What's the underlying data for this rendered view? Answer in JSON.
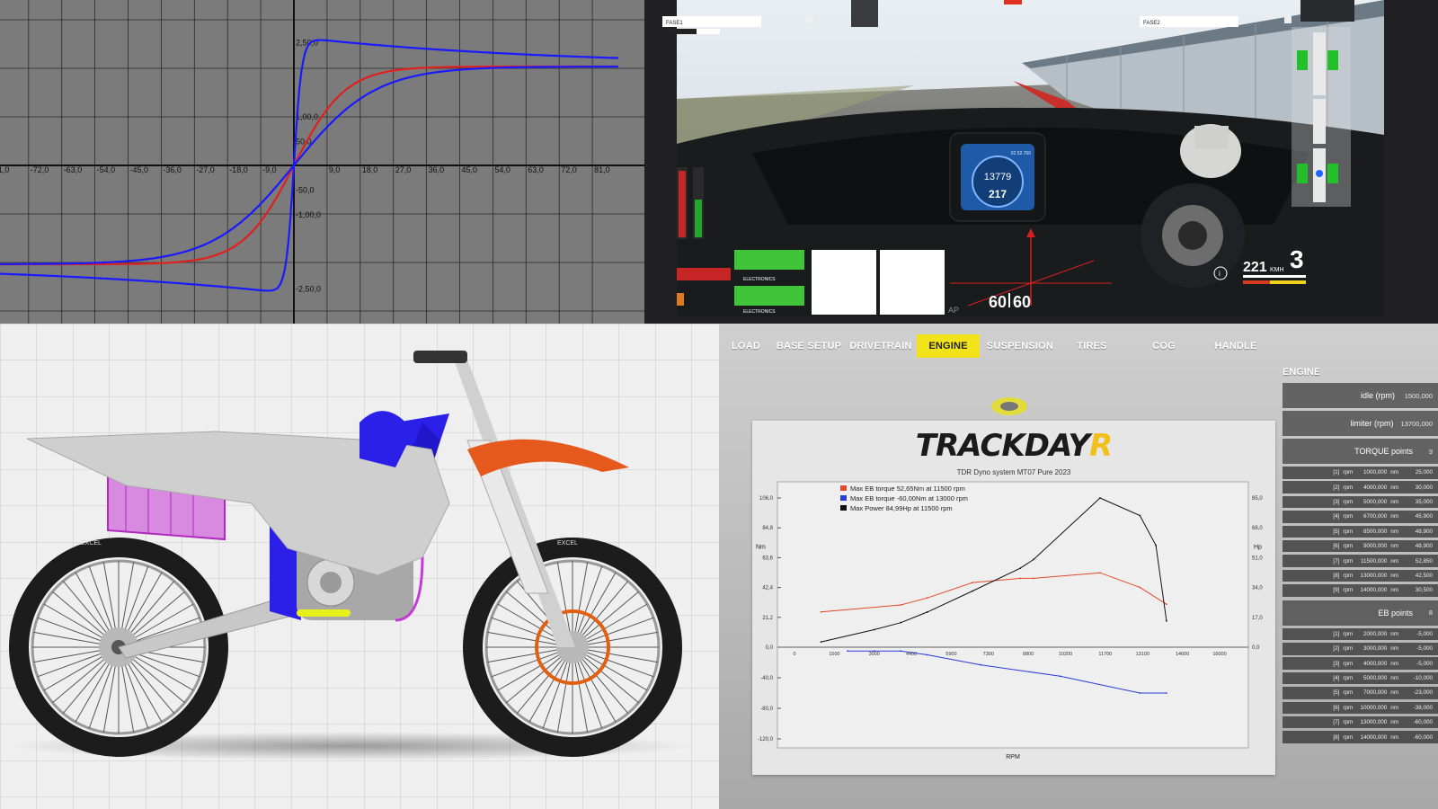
{
  "curve_panel": {
    "x_ticks": [
      "81,0",
      "-72,0",
      "-63,0",
      "-54,0",
      "-45,0",
      "-36,0",
      "-27,0",
      "-18,0",
      "-9,0",
      "9,0",
      "18,0",
      "27,0",
      "36,0",
      "45,0",
      "54,0",
      "63,0",
      "72,0",
      "81,0"
    ],
    "y_ticks": [
      "2,50,0",
      "1,00,0",
      "50,0",
      "-50,0",
      "-1,00,0",
      "-2,50,0"
    ],
    "colors": {
      "bg": "#7b7b7b",
      "grid": "#2b2b2b",
      "curve_a": "#1a1aff",
      "curve_b": "#e02020"
    }
  },
  "sim_panel": {
    "phase_left": "FASE1",
    "phase_right": "FASE2",
    "dash_rpm": "13779",
    "dash_speed": "217",
    "dash_lap": "02.52.766",
    "speed_readout": "221",
    "speed_unit": "KMH",
    "gear": "3",
    "fps_left": "60",
    "fps_right": "60",
    "tile_label": "ELECTRONICS",
    "overlay_text": "AP"
  },
  "bike_panel": {
    "tyre_brand": "EXCEL"
  },
  "tool_panel": {
    "nav": [
      {
        "label": "LOAD",
        "active": false
      },
      {
        "label": "BASE SETUP",
        "active": false
      },
      {
        "label": "DRIVETRAIN",
        "active": false
      },
      {
        "label": "ENGINE",
        "active": true
      },
      {
        "label": "SUSPENSION",
        "active": false
      },
      {
        "label": "TIRES",
        "active": false
      },
      {
        "label": "COG",
        "active": false
      },
      {
        "label": "HANDLE",
        "active": false
      }
    ],
    "section_title": "ENGINE",
    "idle_label": "idle (rpm)",
    "idle_value": "1500,000",
    "limiter_label": "limiter (rpm)",
    "limiter_value": "13700,000",
    "torque_points_label": "TORQUE points",
    "torque_points_count": "9",
    "torque_points": [
      {
        "idx": "[1]",
        "rpm": "1000,000",
        "nm": "25,000"
      },
      {
        "idx": "[2]",
        "rpm": "4000,000",
        "nm": "30,000"
      },
      {
        "idx": "[3]",
        "rpm": "5000,000",
        "nm": "35,000"
      },
      {
        "idx": "[4]",
        "rpm": "6700,000",
        "nm": "45,900"
      },
      {
        "idx": "[5]",
        "rpm": "8500,000",
        "nm": "48,900"
      },
      {
        "idx": "[6]",
        "rpm": "9000,000",
        "nm": "48,900"
      },
      {
        "idx": "[7]",
        "rpm": "11500,000",
        "nm": "52,850"
      },
      {
        "idx": "[8]",
        "rpm": "13000,000",
        "nm": "42,500"
      },
      {
        "idx": "[9]",
        "rpm": "14000,000",
        "nm": "30,500"
      }
    ],
    "eb_points_label": "EB points",
    "eb_points_count": "8",
    "eb_points": [
      {
        "idx": "[1]",
        "rpm": "2000,000",
        "nm": "-5,000"
      },
      {
        "idx": "[2]",
        "rpm": "3000,000",
        "nm": "-5,000"
      },
      {
        "idx": "[3]",
        "rpm": "4000,000",
        "nm": "-5,000"
      },
      {
        "idx": "[4]",
        "rpm": "5000,000",
        "nm": "-10,000"
      },
      {
        "idx": "[5]",
        "rpm": "7000,000",
        "nm": "-23,000"
      },
      {
        "idx": "[6]",
        "rpm": "10000,000",
        "nm": "-38,000"
      },
      {
        "idx": "[7]",
        "rpm": "13000,000",
        "nm": "-60,000"
      },
      {
        "idx": "[8]",
        "rpm": "14000,000",
        "nm": "-60,000"
      }
    ],
    "rpm_word": "rpm",
    "nm_word": "nm",
    "logo_main": "TRACKDAY",
    "logo_accent": "R",
    "dyno_title": "TDR Dyno system MT07 Pure 2023"
  },
  "chart_data": {
    "type": "line",
    "title": "TDR Dyno system MT07 Pure 2023",
    "xlabel": "RPM",
    "ylabel": "Nm",
    "y2label": "Hp",
    "x_ticks": [
      "0",
      "1500",
      "3000",
      "4400",
      "5900",
      "7300",
      "8800",
      "10200",
      "11700",
      "13100",
      "14600",
      "16000"
    ],
    "y_ticks": [
      "106,0",
      "84,8",
      "63,6",
      "42,4",
      "21,2",
      "0,0",
      "-40,0",
      "-80,0",
      "-120,0"
    ],
    "y2_ticks": [
      "85,0",
      "68,0",
      "51,0",
      "34,0",
      "17,0",
      "0,0"
    ],
    "xlim": [
      0,
      16000
    ],
    "ylim": [
      -120,
      106
    ],
    "y2lim": [
      0,
      85
    ],
    "series": [
      {
        "name": "Max EB torque 52,65Nm at 11500 rpm",
        "color": "#e24a2a",
        "axis": "left",
        "x": [
          1000,
          4000,
          5000,
          6700,
          8500,
          9000,
          11500,
          13000,
          14000
        ],
        "y": [
          25,
          30,
          35,
          45.9,
          48.9,
          48.9,
          52.85,
          42.5,
          30.5
        ]
      },
      {
        "name": "Max EB torque -60,00Nm at 13000 rpm",
        "color": "#2a3cd8",
        "axis": "left",
        "x": [
          2000,
          3000,
          4000,
          5000,
          7000,
          10000,
          13000,
          14000
        ],
        "y": [
          -5,
          -5,
          -5,
          -10,
          -23,
          -38,
          -60,
          -60
        ]
      },
      {
        "name": "Max Power 84,99Hp at 11500 rpm",
        "color": "#111111",
        "axis": "right",
        "x": [
          1000,
          3000,
          4000,
          5000,
          6700,
          8500,
          9000,
          11500,
          13000,
          13600,
          14000
        ],
        "y": [
          3,
          10,
          14,
          20,
          32,
          45,
          50,
          84.99,
          75,
          58,
          15
        ]
      }
    ]
  }
}
